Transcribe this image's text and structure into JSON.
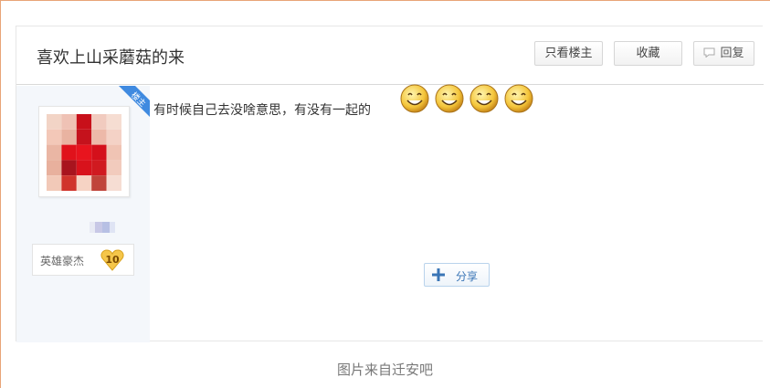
{
  "header": {
    "title": "喜欢上山采蘑菇的来",
    "only_op_label": "只看楼主",
    "favorite_label": "收藏",
    "reply_label": "回复"
  },
  "author": {
    "ribbon": "楼主",
    "name": "英雄豪杰",
    "level": "10"
  },
  "post": {
    "text": "有时候自己去没啥意思，有没有一起的",
    "emoji_count": 4,
    "emoji_icon": "smiley-face-icon"
  },
  "share": {
    "label": "分享"
  },
  "caption": "图片来自迁安吧",
  "colors": {
    "ribbon": "#3f8ae0",
    "share_text": "#3a75b6",
    "level_badge": "#f5c64a",
    "frame_border": "#e8a477"
  }
}
